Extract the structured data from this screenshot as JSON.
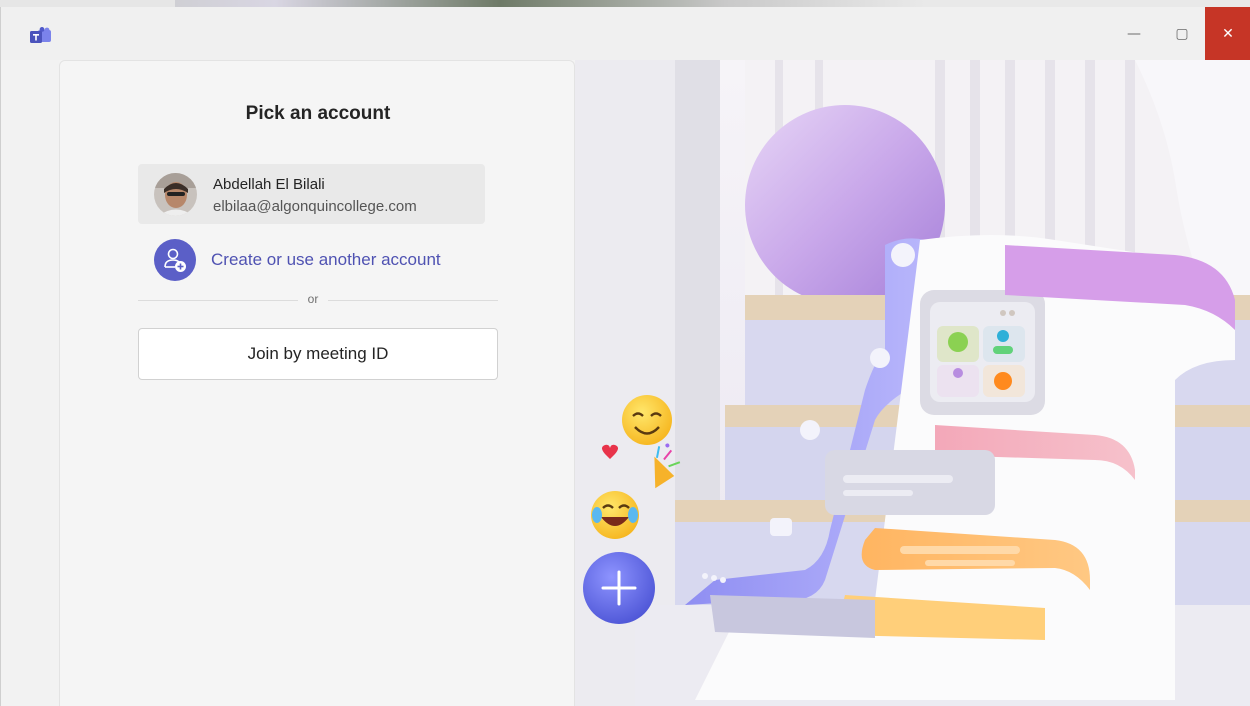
{
  "window": {
    "app_icon": "teams-logo-icon",
    "controls": {
      "minimize": "—",
      "maximize": "▢",
      "close": "✕"
    }
  },
  "panel": {
    "title": "Pick an account",
    "account": {
      "name": "Abdellah El Bilali",
      "email": "elbilaa@algonquincollege.com"
    },
    "create_label": "Create or use another account",
    "divider_text": "or",
    "join_label": "Join by meeting ID"
  },
  "colors": {
    "accent": "#5b5fc7",
    "link": "#4f52b2",
    "close_hover": "#c42b1c"
  }
}
